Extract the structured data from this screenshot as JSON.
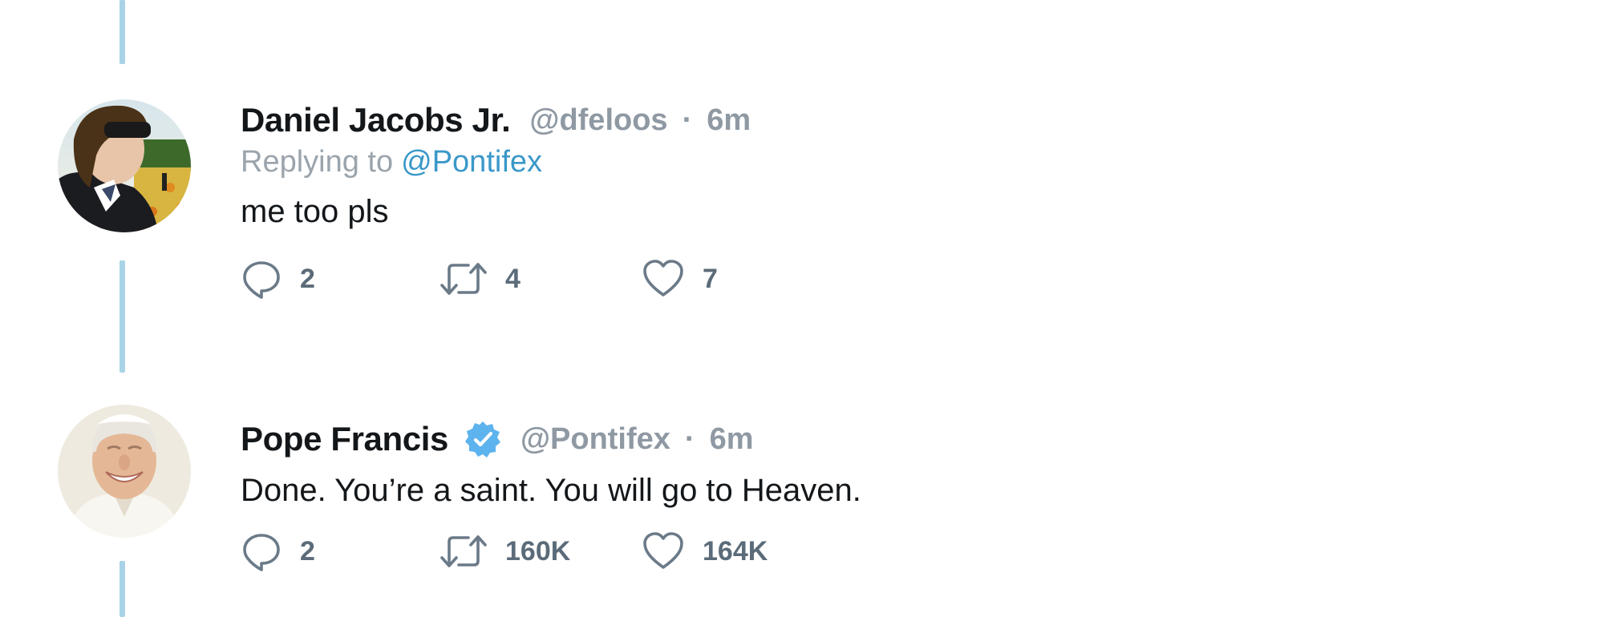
{
  "tweets": [
    {
      "display_name": "Daniel Jacobs Jr.",
      "handle": "@dfeloos",
      "separator": "·",
      "time": "6m",
      "replying_prefix": "Replying to",
      "replying_handle": "@Pontifex",
      "text": "me too pls",
      "verified": false,
      "actions": {
        "reply": {
          "icon": "reply-icon",
          "count": "2"
        },
        "retweet": {
          "icon": "retweet-icon",
          "count": "4"
        },
        "like": {
          "icon": "heart-icon",
          "count": "7"
        }
      }
    },
    {
      "display_name": "Pope Francis",
      "handle": "@Pontifex",
      "separator": "·",
      "time": "6m",
      "text": "Done. You’re a saint. You will go to Heaven.",
      "verified": true,
      "actions": {
        "reply": {
          "icon": "reply-icon",
          "count": "2"
        },
        "retweet": {
          "icon": "retweet-icon",
          "count": "160K"
        },
        "like": {
          "icon": "heart-icon",
          "count": "164K"
        }
      }
    }
  ],
  "colors": {
    "thread_line": "#a9d3e6",
    "mention": "#3a98c9",
    "verified": "#5db3ee",
    "muted": "#8f99a3",
    "icon": "#6b7a88",
    "text": "#14171a"
  }
}
